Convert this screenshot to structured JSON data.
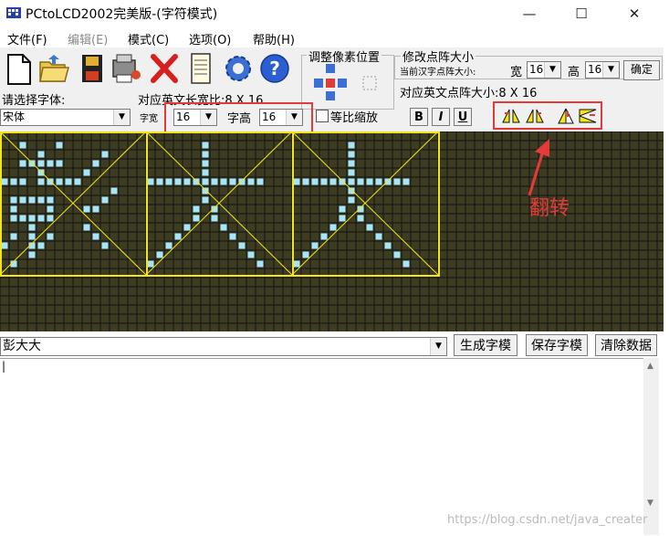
{
  "window": {
    "title": "PCtoLCD2002完美版-(字符模式)",
    "minimize_glyph": "—",
    "maximize_glyph": "☐",
    "close_glyph": "✕"
  },
  "menu": {
    "items": [
      {
        "label": "文件(F)",
        "enabled": true
      },
      {
        "label": "编辑(E)",
        "enabled": false
      },
      {
        "label": "模式(C)",
        "enabled": true
      },
      {
        "label": "选项(O)",
        "enabled": true
      },
      {
        "label": "帮助(H)",
        "enabled": true
      }
    ]
  },
  "toolbar": {
    "icons": [
      "new-file-icon",
      "open-folder-icon",
      "save-disk-icon",
      "settings-printer-icon",
      "delete-x-icon",
      "notepad-icon",
      "gear-icon",
      "help-icon"
    ]
  },
  "adjust_pixel": {
    "title": "调整像素位置"
  },
  "resize_dots": {
    "title": "修改点阵大小",
    "current_label": "当前汉字点阵大小:",
    "width_label": "宽",
    "width_value": "16",
    "height_label": "高",
    "height_value": "16",
    "confirm_label": "确定",
    "english_dot_label": "对应英文点阵大小:8 X 16"
  },
  "font": {
    "select_label": "请选择字体:",
    "font_value": "宋体",
    "ratio_label": "对应英文长宽比:8 X 16",
    "char_width_label": "字宽",
    "char_width_value": "16",
    "char_height_label": "字高",
    "char_height_value": "16",
    "proportional_label": "等比缩放"
  },
  "format_buttons": {
    "bold": "B",
    "italic": "I",
    "underline": "U"
  },
  "annotation": {
    "text": "翻转",
    "color": "#e53a3a"
  },
  "grid": {
    "background": "#3d3b20",
    "line_color": "#1a1a1a",
    "pixel_on": "#a6e6f6",
    "frame_color": "#f2e51c",
    "characters": [
      "彭",
      "大",
      "大"
    ]
  },
  "bottom": {
    "input_text": "彭大大",
    "generate_button": "生成字模",
    "save_button": "保存字模",
    "clear_button": "清除数据",
    "output_text": "|"
  },
  "watermark": "https://blog.csdn.net/java_creater"
}
